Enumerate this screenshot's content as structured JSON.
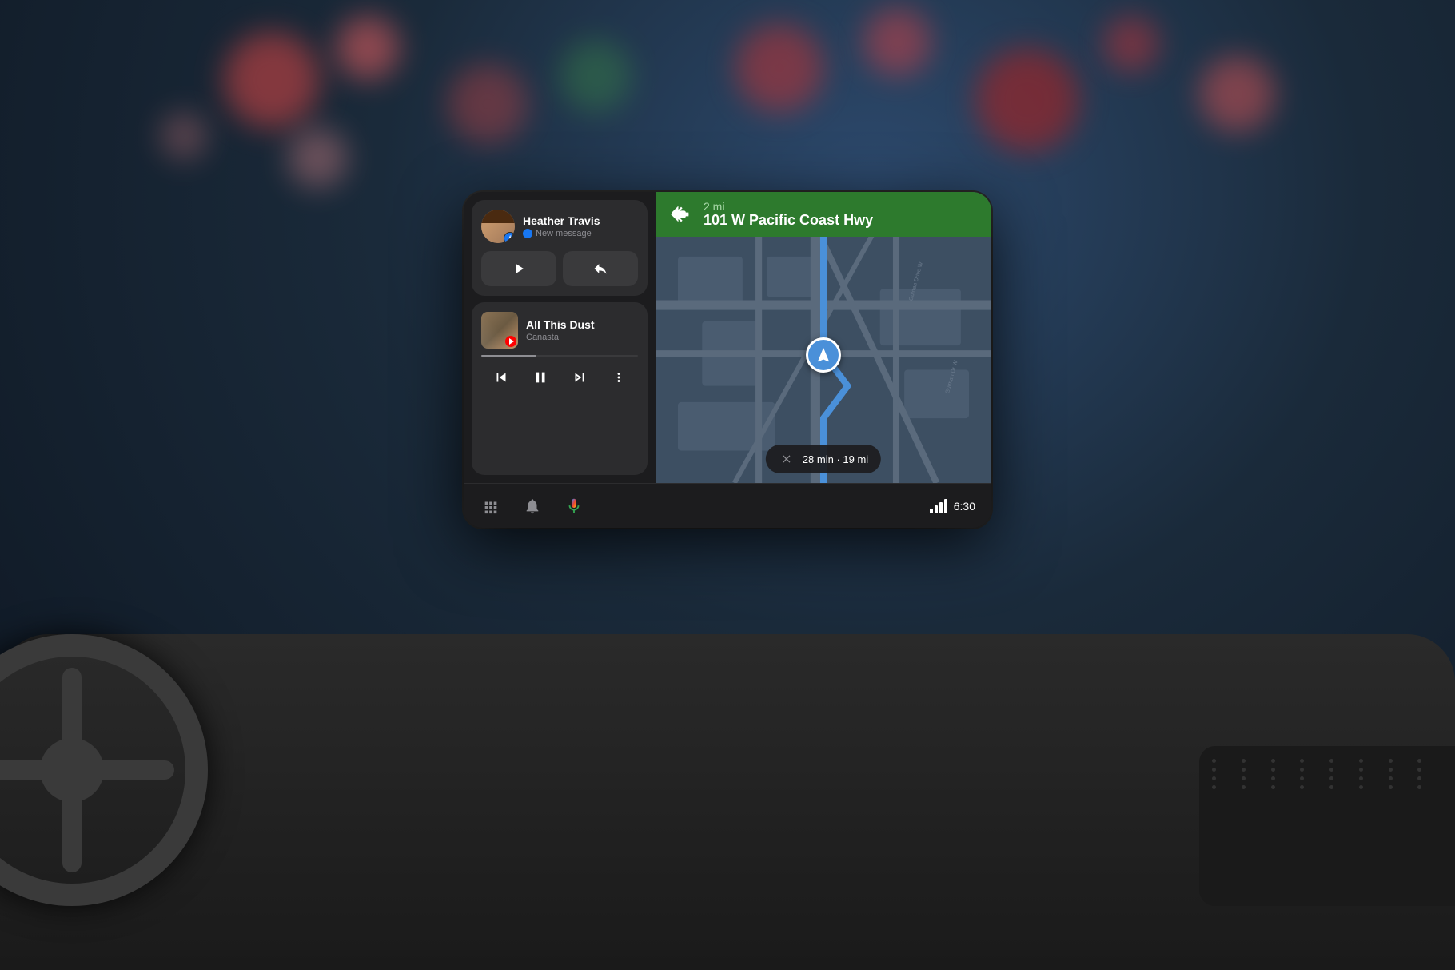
{
  "background": {
    "bokeh_colors": [
      "#e05050",
      "#ff8080",
      "#50a050",
      "#8080e0",
      "#e08050",
      "#60b060",
      "#d04040",
      "#ff6060"
    ],
    "description": "Night city bokeh background"
  },
  "dashboard": {
    "description": "Car dashboard interior"
  },
  "display": {
    "left_panel": {
      "message_card": {
        "contact_name": "Heather Travis",
        "subtitle": "New message",
        "play_button_label": "Play",
        "reply_button_label": "Reply"
      },
      "music_card": {
        "song_title": "All This Dust",
        "artist": "Canasta",
        "app": "YouTube Music"
      },
      "bottom_bar": {
        "grid_icon": "grid-icon",
        "bell_icon": "bell-icon",
        "mic_icon": "mic-icon",
        "time": "6:30"
      }
    },
    "map_panel": {
      "nav_header": {
        "arrow_direction": "turn-left",
        "distance": "2 mi",
        "road_name": "101 W Pacific Coast Hwy"
      },
      "eta": {
        "duration": "28 min",
        "distance": "19 mi",
        "full_text": "28 min · 19 mi"
      }
    }
  }
}
